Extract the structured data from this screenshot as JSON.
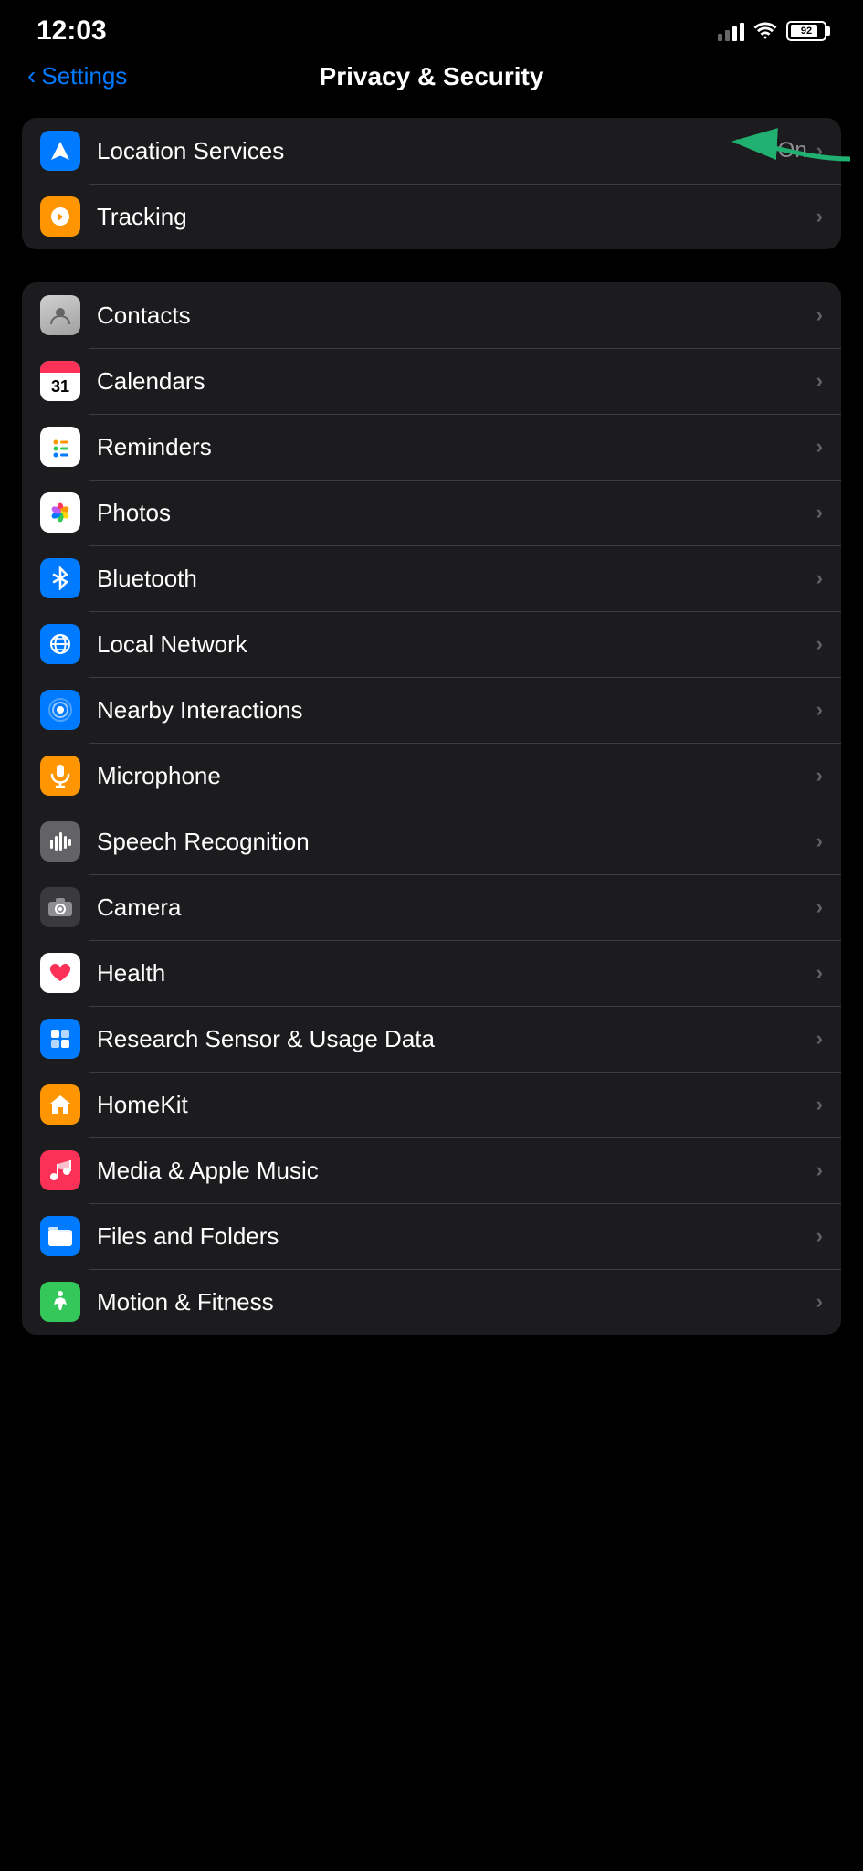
{
  "statusBar": {
    "time": "12:03",
    "battery": "92",
    "batteryPercent": 92
  },
  "navBar": {
    "backLabel": "Settings",
    "title": "Privacy & Security"
  },
  "topSection": {
    "rows": [
      {
        "id": "location-services",
        "label": "Location Services",
        "value": "On",
        "iconBg": "#007AFF",
        "iconType": "location"
      },
      {
        "id": "tracking",
        "label": "Tracking",
        "value": "",
        "iconBg": "#FF9500",
        "iconType": "tracking"
      }
    ]
  },
  "mainSection": {
    "rows": [
      {
        "id": "contacts",
        "label": "Contacts",
        "iconType": "contacts"
      },
      {
        "id": "calendars",
        "label": "Calendars",
        "iconType": "calendars"
      },
      {
        "id": "reminders",
        "label": "Reminders",
        "iconType": "reminders"
      },
      {
        "id": "photos",
        "label": "Photos",
        "iconType": "photos"
      },
      {
        "id": "bluetooth",
        "label": "Bluetooth",
        "iconType": "bluetooth",
        "iconBg": "#007AFF"
      },
      {
        "id": "local-network",
        "label": "Local Network",
        "iconType": "globe",
        "iconBg": "#007AFF"
      },
      {
        "id": "nearby-interactions",
        "label": "Nearby Interactions",
        "iconType": "nearby",
        "iconBg": "#007AFF"
      },
      {
        "id": "microphone",
        "label": "Microphone",
        "iconType": "microphone",
        "iconBg": "#FF9500"
      },
      {
        "id": "speech-recognition",
        "label": "Speech Recognition",
        "iconType": "speech",
        "iconBg": "#636366"
      },
      {
        "id": "camera",
        "label": "Camera",
        "iconType": "camera",
        "iconBg": "#3a3a3c"
      },
      {
        "id": "health",
        "label": "Health",
        "iconType": "health"
      },
      {
        "id": "research",
        "label": "Research Sensor & Usage Data",
        "iconType": "research",
        "iconBg": "#007AFF"
      },
      {
        "id": "homekit",
        "label": "HomeKit",
        "iconType": "homekit",
        "iconBg": "#FF9500"
      },
      {
        "id": "media-apple-music",
        "label": "Media & Apple Music",
        "iconType": "music",
        "iconBg": "#FC3158"
      },
      {
        "id": "files-and-folders",
        "label": "Files and Folders",
        "iconType": "files",
        "iconBg": "#007AFF"
      },
      {
        "id": "motion-fitness",
        "label": "Motion & Fitness",
        "iconType": "motion",
        "iconBg": "#34C759"
      }
    ]
  }
}
